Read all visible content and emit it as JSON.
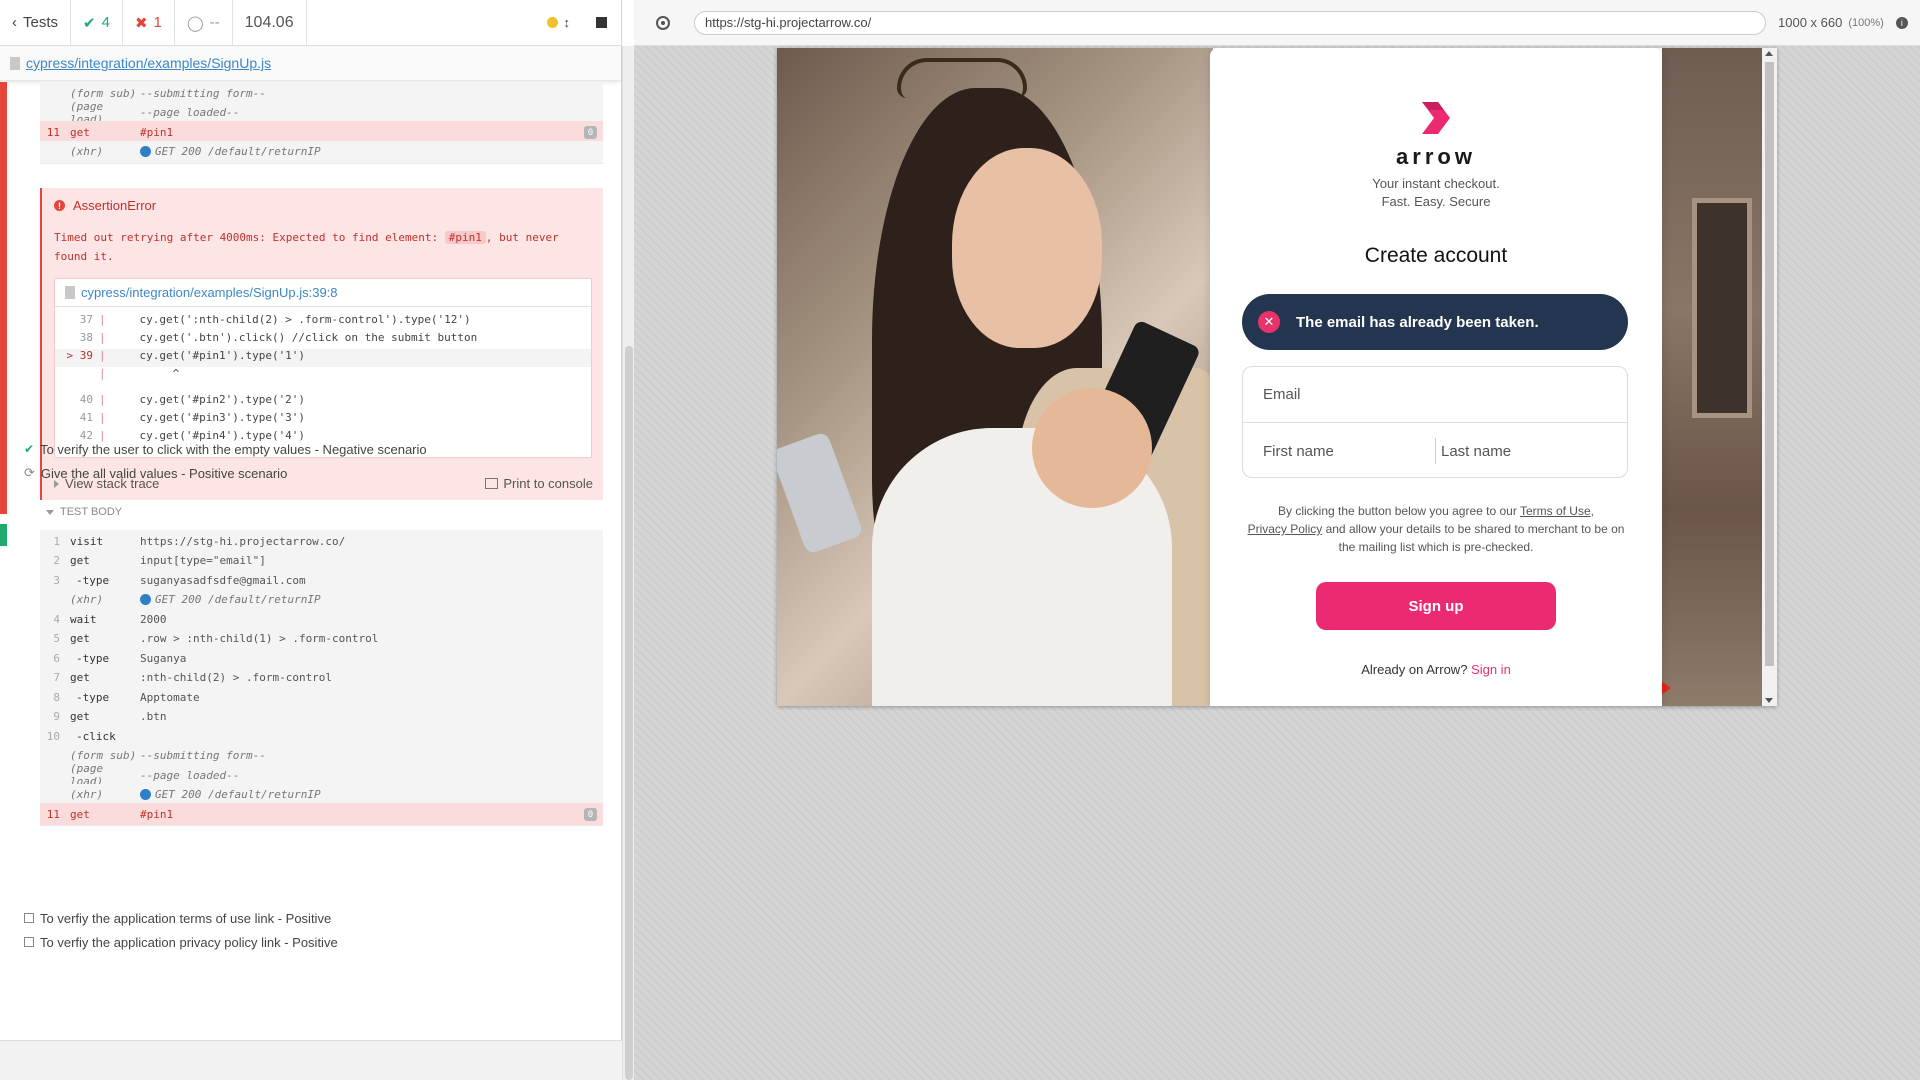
{
  "toolbar": {
    "tests_label": "Tests",
    "passed": "4",
    "failed": "1",
    "pending": "--",
    "duration": "104.06"
  },
  "spec": {
    "path": "cypress/integration/examples/SignUp.js"
  },
  "commands_top": [
    {
      "num": "",
      "name": "(form sub)",
      "msg": "--submitting form--",
      "italic": true
    },
    {
      "num": "",
      "name": "(page load)",
      "msg": "--page loaded--",
      "italic": true
    },
    {
      "num": "11",
      "name": "get",
      "msg": "#pin1",
      "failed": true
    },
    {
      "num": "",
      "name": "(xhr)",
      "msg": "GET 200 /default/returnIP",
      "italic": true,
      "xhr": true
    }
  ],
  "error": {
    "title": "AssertionError",
    "message_before": "Timed out retrying after 4000ms: Expected to find element: ",
    "message_code": "#pin1",
    "message_after": ", but never found it.",
    "file_link": "cypress/integration/examples/SignUp.js:39:8",
    "code_lines": [
      {
        "ln": "37",
        "src": "    cy.get(':nth-child(2) > .form-control').type('12')"
      },
      {
        "ln": "38",
        "src": "    cy.get('.btn').click() //click on the submit button"
      },
      {
        "ln": "> 39",
        "src": "    cy.get('#pin1').type('1')",
        "hl": true
      },
      {
        "ln": "",
        "src": "         ^"
      },
      {
        "ln": "40",
        "src": "    cy.get('#pin2').type('2')"
      },
      {
        "ln": "41",
        "src": "    cy.get('#pin3').type('3')"
      },
      {
        "ln": "42",
        "src": "    cy.get('#pin4').type('4')"
      }
    ],
    "view_stack": "View stack trace",
    "print_console": "Print to console"
  },
  "tests": [
    {
      "title": "To verify the user to click with the empty values - Negative scenario",
      "state": "passed"
    },
    {
      "title": "Give the all valid values - Positive scenario",
      "state": "running"
    },
    {
      "title": "To verfiy the application terms of use link - Positive",
      "state": "pending"
    },
    {
      "title": "To verfiy the application privacy policy link - Positive",
      "state": "pending"
    }
  ],
  "test_body_label": "TEST BODY",
  "commands_body": [
    {
      "num": "1",
      "name": "visit",
      "msg": "https://stg-hi.projectarrow.co/"
    },
    {
      "num": "2",
      "name": "get",
      "msg": "input[type=\"email\"]"
    },
    {
      "num": "3",
      "name": "-type",
      "msg": "suganyasadfsdfe@gmail.com",
      "sub": true
    },
    {
      "num": "",
      "name": "(xhr)",
      "msg": "GET 200 /default/returnIP",
      "italic": true,
      "xhr": true
    },
    {
      "num": "4",
      "name": "wait",
      "msg": "2000"
    },
    {
      "num": "5",
      "name": "get",
      "msg": ".row > :nth-child(1) > .form-control"
    },
    {
      "num": "6",
      "name": "-type",
      "msg": "Suganya",
      "sub": true
    },
    {
      "num": "7",
      "name": "get",
      "msg": ":nth-child(2) > .form-control"
    },
    {
      "num": "8",
      "name": "-type",
      "msg": "Apptomate",
      "sub": true
    },
    {
      "num": "9",
      "name": "get",
      "msg": ".btn"
    },
    {
      "num": "10",
      "name": "-click",
      "msg": "",
      "sub": true
    },
    {
      "num": "",
      "name": "(form sub)",
      "msg": "--submitting form--",
      "italic": true
    },
    {
      "num": "",
      "name": "(page load)",
      "msg": "--page loaded--",
      "italic": true
    },
    {
      "num": "",
      "name": "(xhr)",
      "msg": "GET 200 /default/returnIP",
      "italic": true,
      "xhr": true
    },
    {
      "num": "11",
      "name": "get",
      "msg": "#pin1",
      "failed": true
    }
  ],
  "browser": {
    "url": "https://stg-hi.projectarrow.co/",
    "viewport": "1000 x 660",
    "zoom": "(100%)"
  },
  "app": {
    "brand": "arrow",
    "tagline1": "Your instant checkout.",
    "tagline2": "Fast. Easy. Secure",
    "heading": "Create account",
    "toast": "The email has already been taken.",
    "email_placeholder": "Email",
    "first_name_placeholder": "First name",
    "last_name_placeholder": "Last name",
    "terms_pre": "By clicking the button below you agree to our ",
    "terms_link": "Terms of Use",
    "terms_mid1": ",",
    "privacy_link": "Privacy Policy",
    "terms_post": " and allow your details to be shared to merchant to be on the mailing list which is pre-checked.",
    "signup_label": "Sign up",
    "already_text": "Already on Arrow? ",
    "signin_label": "Sign in"
  },
  "colors": {
    "brand_pink": "#eb2a72",
    "toast_bg": "#243550",
    "pass_green": "#1fa971",
    "fail_red": "#e4453a",
    "link_blue": "#3c87c5"
  }
}
